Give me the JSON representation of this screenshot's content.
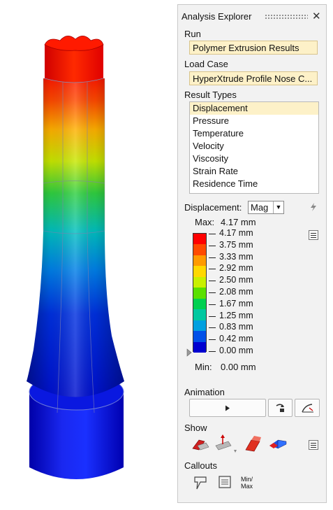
{
  "panel": {
    "title": "Analysis Explorer",
    "close_icon": "close-icon",
    "run_label": "Run",
    "run_value": "Polymer Extrusion Results",
    "loadcase_label": "Load Case",
    "loadcase_value": "HyperXtrude Profile Nose C...",
    "result_types_label": "Result Types",
    "result_types": [
      "Displacement",
      "Pressure",
      "Temperature",
      "Velocity",
      "Viscosity",
      "Strain Rate",
      "Residence Time"
    ],
    "selected_result": "Displacement",
    "component_label": "Displacement:",
    "component_value": "Mag",
    "max_label": "Max:",
    "max_value": "4.17 mm",
    "min_label": "Min:",
    "min_value": "0.00 mm",
    "legend_ticks": [
      "4.17 mm",
      "3.75 mm",
      "3.33 mm",
      "2.92 mm",
      "2.50 mm",
      "2.08 mm",
      "1.67 mm",
      "1.25 mm",
      "0.83 mm",
      "0.42 mm",
      "0.00 mm"
    ],
    "legend_colors": [
      "#ff0000",
      "#ff4a00",
      "#ff9a00",
      "#ffd800",
      "#c8f000",
      "#5ae000",
      "#00d050",
      "#00c8a0",
      "#00a0e0",
      "#0050e8",
      "#0000d0"
    ],
    "animation_label": "Animation",
    "show_label": "Show",
    "callouts_label": "Callouts",
    "minmax_label_1": "Min/",
    "minmax_label_2": "Max"
  }
}
